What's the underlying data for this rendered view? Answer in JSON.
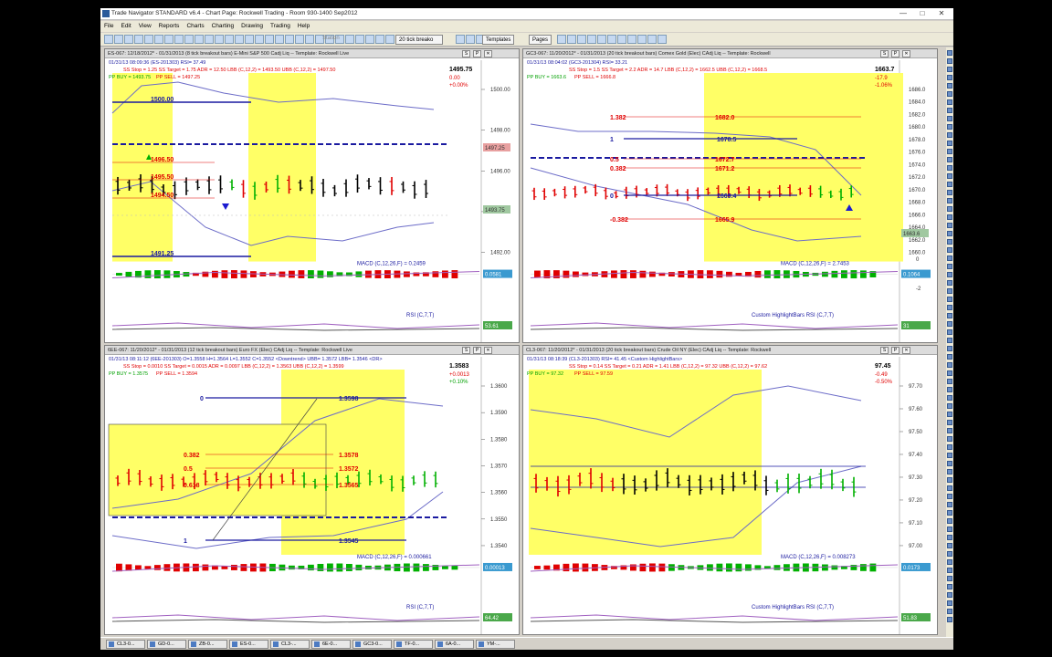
{
  "window": {
    "title": "Trade Navigator STANDARD v6.4  -  Chart Page: Rockwell Trading - Room 930-1400 Sep2012"
  },
  "menu": [
    "File",
    "Edit",
    "View",
    "Reports",
    "Charts",
    "Charting",
    "Drawing",
    "Trading",
    "Help"
  ],
  "toolbar": {
    "bar_type": "20 tick breako",
    "templates": "Templates",
    "pages": "Pages",
    "status": "Station"
  },
  "colors": {
    "highlight": "#ffff66",
    "up": "#00b000",
    "down": "#e00000",
    "neutral": "#000000",
    "band": "#6c6cc8",
    "level": "#1a1aa0"
  },
  "panes": [
    {
      "header": "ES-067: 12/18/2012* - 01/31/2013  (8 tick breakout bars)   E-Mini S&P 500 Cadj Liq  --  Template: Rockwell Live",
      "bar1": "01/31/13 08:09:36 (ES-201303)  RSI= 37.49",
      "bar2a": "SS Stop = 1.25   SS Target = 1.75   ADR = 12.50   LBB (C,12,2) = 1493.50   UBB (C,12,2) = 1497.50",
      "bar3a": "PP BUY = 1493.75",
      "bar3b": "PP SELL = 1497.25",
      "last": "1495.75",
      "chg": "0.00",
      "pct": "+0.00%",
      "prices": [
        "1500.00",
        "1498.00",
        "1496.00",
        "1494.00",
        "1492.00"
      ],
      "marks": [
        "1497.25",
        "1493.75"
      ],
      "levels": [
        {
          "label": "1500.00",
          "color": "blue"
        },
        {
          "label": "1496.50",
          "color": "red"
        },
        {
          "label": "1495.50",
          "color": "red"
        },
        {
          "label": "1494.50",
          "color": "red"
        },
        {
          "label": "1491.25",
          "color": "blue"
        }
      ],
      "macd": "MACD (C,12,26,F) = 0.2459",
      "macd_box": "0.0581",
      "rsi": "RSI (C,7,T)",
      "rsi_box": "53.61"
    },
    {
      "header": "GC3-067: 11/20/2012* - 01/31/2013  (20 tick breakout bars)   Comex Gold (Elec) CAdj Liq  --  Template: Rockwell",
      "bar1": "01/31/13 08:04:02 (GC3-201304)  RSI= 33.21",
      "bar2a": "SS Stop = 1.5   SS Target = 2.2   ADR = 14.7   LBB (C,12,2) = 1662.5   UBB (C,12,2) = 1668.5",
      "bar3a": "PP BUY = 1663.6",
      "bar3b": "PP SELL = 1666.8",
      "last": "1663.7",
      "chg": "-17.9",
      "pct": "-1.06%",
      "prices": [
        "1686.0",
        "1684.0",
        "1682.0",
        "1680.0",
        "1678.0",
        "1676.0",
        "1674.0",
        "1672.0",
        "1670.0",
        "1668.0",
        "1666.0",
        "1664.0",
        "1662.0",
        "1660.0"
      ],
      "marks": [
        "1663.6"
      ],
      "fib_left": [
        "1.382",
        "1",
        "0.5",
        "0.382",
        "0",
        "-0.382"
      ],
      "fib_right": [
        "1682.0",
        "1678.5",
        "1672.7",
        "1671.2",
        "1669.4",
        "1665.9"
      ],
      "macd": "MACD (C,12,26,F) = 2.7453",
      "macd_box": "0.1064",
      "rsi": "Custom HighlightBars   RSI (C,7,T)",
      "rsi_box": "31",
      "axis_extra": [
        "0",
        "-2"
      ]
    },
    {
      "header": "6EE-067: 11/20/2012* - 01/31/2013  (12 tick breakout bars)   Euro FX (Elec) CAdj Liq  --  Template: Rockwell Live",
      "bar1": "01/31/13 08:11:12 (6EE-201303)  O=1.3558  H=1.3564  L=1.3552  C=1.3552  <Downtrend>  UBB= 1.3572  LBB= 1.3546  <DR>",
      "bar2a": "SS Stop = 0.0010   SS Target = 0.0015   ADR = 0.0097   LBB (C,12,2) = 1.3563   UBB (C,12,2) = 1.3599",
      "bar3a": "PP BUY = 1.3575",
      "bar3b": "PP SELL = 1.3594",
      "last": "1.3583",
      "chg": "+0.0013",
      "pct": "+0.10%",
      "prices": [
        "1.3600",
        "1.3590",
        "1.3580",
        "1.3570",
        "1.3560",
        "1.3550",
        "1.3540"
      ],
      "fib_left": [
        "0",
        "0.382",
        "0.5",
        "0.618",
        "1"
      ],
      "fib_right": [
        "1.3598",
        "1.3578",
        "1.3572",
        "1.3565",
        "1.3545"
      ],
      "macd": "MACD (C,12,26,F) = 0.000661",
      "macd_box": "0.00013",
      "rsi": "RSI (C,7,T)",
      "rsi_box": "64.42"
    },
    {
      "header": "CL3-067: 11/20/2012* - 01/31/2013  (20 tick breakout bars)   Crude Oil NY (Elec) CAdj Liq  --  Template: Rockwell",
      "bar1": "01/31/13 08:18:39 (CL3-201303)  RSI= 41.45  <Custom HighlightBars>",
      "bar2a": "SS Stop = 0.14   SS Target = 0.21   ADR = 1.41   LBB (C,12,2) = 97.32   UBB (C,12,2) = 97.62",
      "bar3a": "PP BUY = 97.32",
      "bar3b": "PP SELL = 97.59",
      "last": "97.45",
      "chg": "-0.49",
      "pct": "-0.50%",
      "prices": [
        "97.70",
        "97.60",
        "97.50",
        "97.40",
        "97.30",
        "97.20",
        "97.10",
        "97.00"
      ],
      "macd": "MACD (C,12,26,F) = 0.008273",
      "macd_box": "0.0173",
      "rsi": "Custom HighlightBars   RSI (C,7,T)",
      "rsi_box": "51.83"
    }
  ],
  "taskbar": [
    "CL3-0...",
    "GD-0...",
    "ZB-0...",
    "ES-0...",
    "CL3-...",
    "6E-0...",
    "GC3-0...",
    "TF-0...",
    "6A-0...",
    "YM-..."
  ]
}
